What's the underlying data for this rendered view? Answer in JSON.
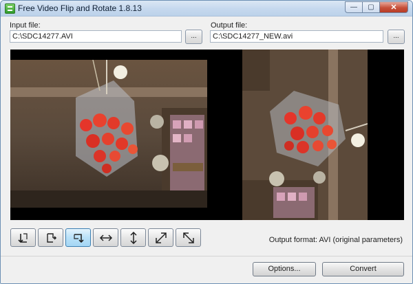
{
  "window": {
    "title": "Free Video Flip and Rotate 1.8.13"
  },
  "controls": {
    "minimize": "—",
    "maximize": "▢",
    "close": "✕"
  },
  "input": {
    "label": "Input file:",
    "value": "C:\\SDC14277.AVI",
    "browse": "..."
  },
  "output": {
    "label": "Output file:",
    "value": "C:\\SDC14277_NEW.avi",
    "browse": "..."
  },
  "toolbar": {
    "buttons": [
      {
        "name": "rotate-left-button",
        "icon": "rotate-left-icon",
        "active": false
      },
      {
        "name": "rotate-right-button",
        "icon": "rotate-right-icon",
        "active": false
      },
      {
        "name": "rotate-down-button",
        "icon": "rotate-down-icon",
        "active": true
      },
      {
        "name": "flip-horizontal-button",
        "icon": "flip-horizontal-icon",
        "active": false
      },
      {
        "name": "flip-vertical-button",
        "icon": "flip-vertical-icon",
        "active": false
      },
      {
        "name": "transpose-button",
        "icon": "diagonal-arrow-ne-icon",
        "active": false
      },
      {
        "name": "transverse-button",
        "icon": "diagonal-arrow-se-icon",
        "active": false
      }
    ]
  },
  "status": {
    "output_format": "Output format: AVI (original parameters)"
  },
  "actions": {
    "options": "Options...",
    "convert": "Convert"
  }
}
